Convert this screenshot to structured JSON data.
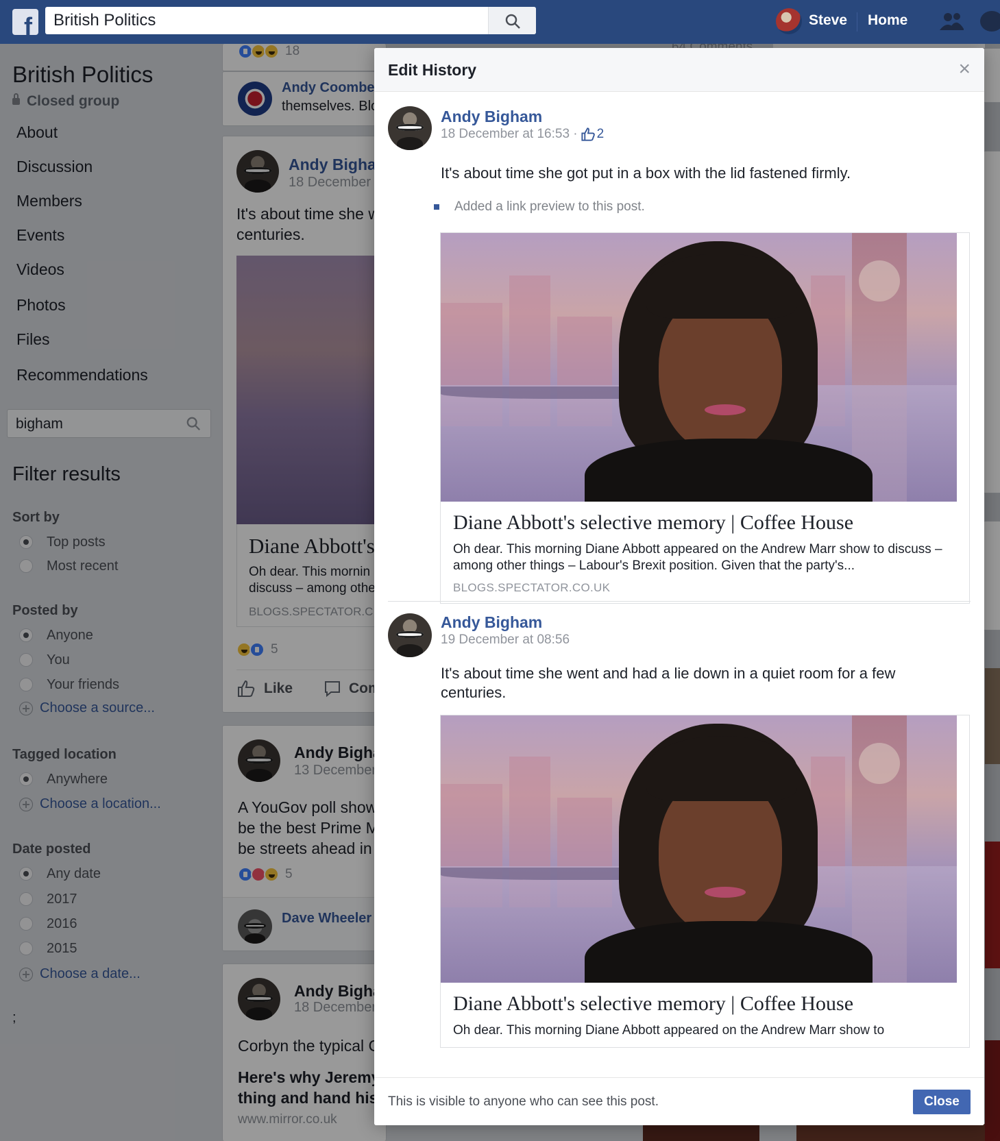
{
  "topbar": {
    "logo": "f",
    "search_value": "British Politics",
    "user_name": "Steve",
    "home_label": "Home"
  },
  "sidebar": {
    "group_name": "British Politics",
    "group_privacy": "Closed group",
    "nav": [
      "About",
      "Discussion",
      "Members",
      "Events",
      "Videos",
      "Photos",
      "Files",
      "Recommendations"
    ],
    "search_value": "bigham",
    "filter_title": "Filter results",
    "sort_by": {
      "heading": "Sort by",
      "options": [
        "Top posts",
        "Most recent"
      ],
      "selected": 0
    },
    "posted_by": {
      "heading": "Posted by",
      "options": [
        "Anyone",
        "You",
        "Your friends"
      ],
      "selected": 0,
      "add_label": "Choose a source..."
    },
    "tagged_location": {
      "heading": "Tagged location",
      "options": [
        "Anywhere"
      ],
      "selected": 0,
      "add_label": "Choose a location..."
    },
    "date_posted": {
      "heading": "Date posted",
      "options": [
        "Any date",
        "2017",
        "2016",
        "2015"
      ],
      "selected": 0,
      "add_label": "Choose a date..."
    },
    "stray": ";"
  },
  "feed": {
    "top_count": "18",
    "top_comments": "64 Comments",
    "coombes": {
      "name": "Andy Coombes",
      "text": "themselves. Blo"
    },
    "post1": {
      "name": "Andy Bighar",
      "date": "18 December a",
      "text_lines": [
        "It's about time she w",
        "centuries."
      ],
      "link_title": "Diane Abbott's",
      "link_desc_lines": [
        "Oh dear. This mornin",
        "discuss – among othe"
      ],
      "link_domain": "BLOGS.SPECTATOR.C",
      "reaction_count": "5",
      "like_label": "Like",
      "comment_label": "Com"
    },
    "post2": {
      "name": "Andy Bigha",
      "date": "13 December",
      "text_lines": [
        "A YouGov poll show",
        "be the best Prime M",
        "be streets ahead in"
      ],
      "reaction_count": "5",
      "commenter": "Dave Wheeler A"
    },
    "post3": {
      "name": "Andy Bigha",
      "date": "18 December",
      "text": "Corbyn the typical C",
      "bold_lines": [
        "Here's why Jeremy",
        "thing and hand his"
      ],
      "domain": "www.mirror.co.uk"
    }
  },
  "modal": {
    "title": "Edit History",
    "close_x": "×",
    "entries": [
      {
        "name": "Andy Bigham",
        "date": "18 December at 16:53 · ",
        "likes": "2",
        "text": "It's about time she got put in a box with the lid fastened firmly.",
        "change": "Added a link preview to this post.",
        "link_title": "Diane Abbott's selective memory | Coffee House",
        "link_desc": "Oh dear. This morning Diane Abbott appeared on the Andrew Marr show to discuss – among other things – Labour's Brexit position. Given that the party's...",
        "link_domain": "BLOGS.SPECTATOR.CO.UK"
      },
      {
        "name": "Andy Bigham",
        "date": "19 December at 08:56",
        "text": "It's about time she went and had a lie down in a quiet room for a few centuries.",
        "link_title": "Diane Abbott's selective memory | Coffee House",
        "link_desc": "Oh dear. This morning Diane Abbott appeared on the Andrew Marr show to"
      }
    ],
    "footer_note": "This is visible to anyone who can see this post.",
    "close_label": "Close"
  }
}
